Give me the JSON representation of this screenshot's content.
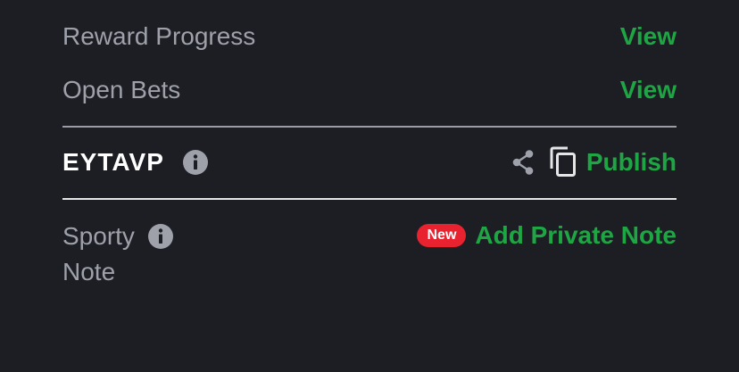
{
  "reward_progress": {
    "label": "Reward Progress",
    "action": "View"
  },
  "open_bets": {
    "label": "Open Bets",
    "action": "View"
  },
  "booking": {
    "code": "EYTAVP",
    "publish_label": "Publish"
  },
  "note": {
    "label_line1": "Sporty",
    "label_line2": "Note",
    "badge": "New",
    "action": "Add Private Note"
  },
  "colors": {
    "background": "#1c1e24",
    "accent_green": "#1fa644",
    "badge_red": "#e8222e",
    "muted_text": "#9ea1aa"
  },
  "icons": [
    "info-icon",
    "share-icon",
    "copy-icon"
  ]
}
